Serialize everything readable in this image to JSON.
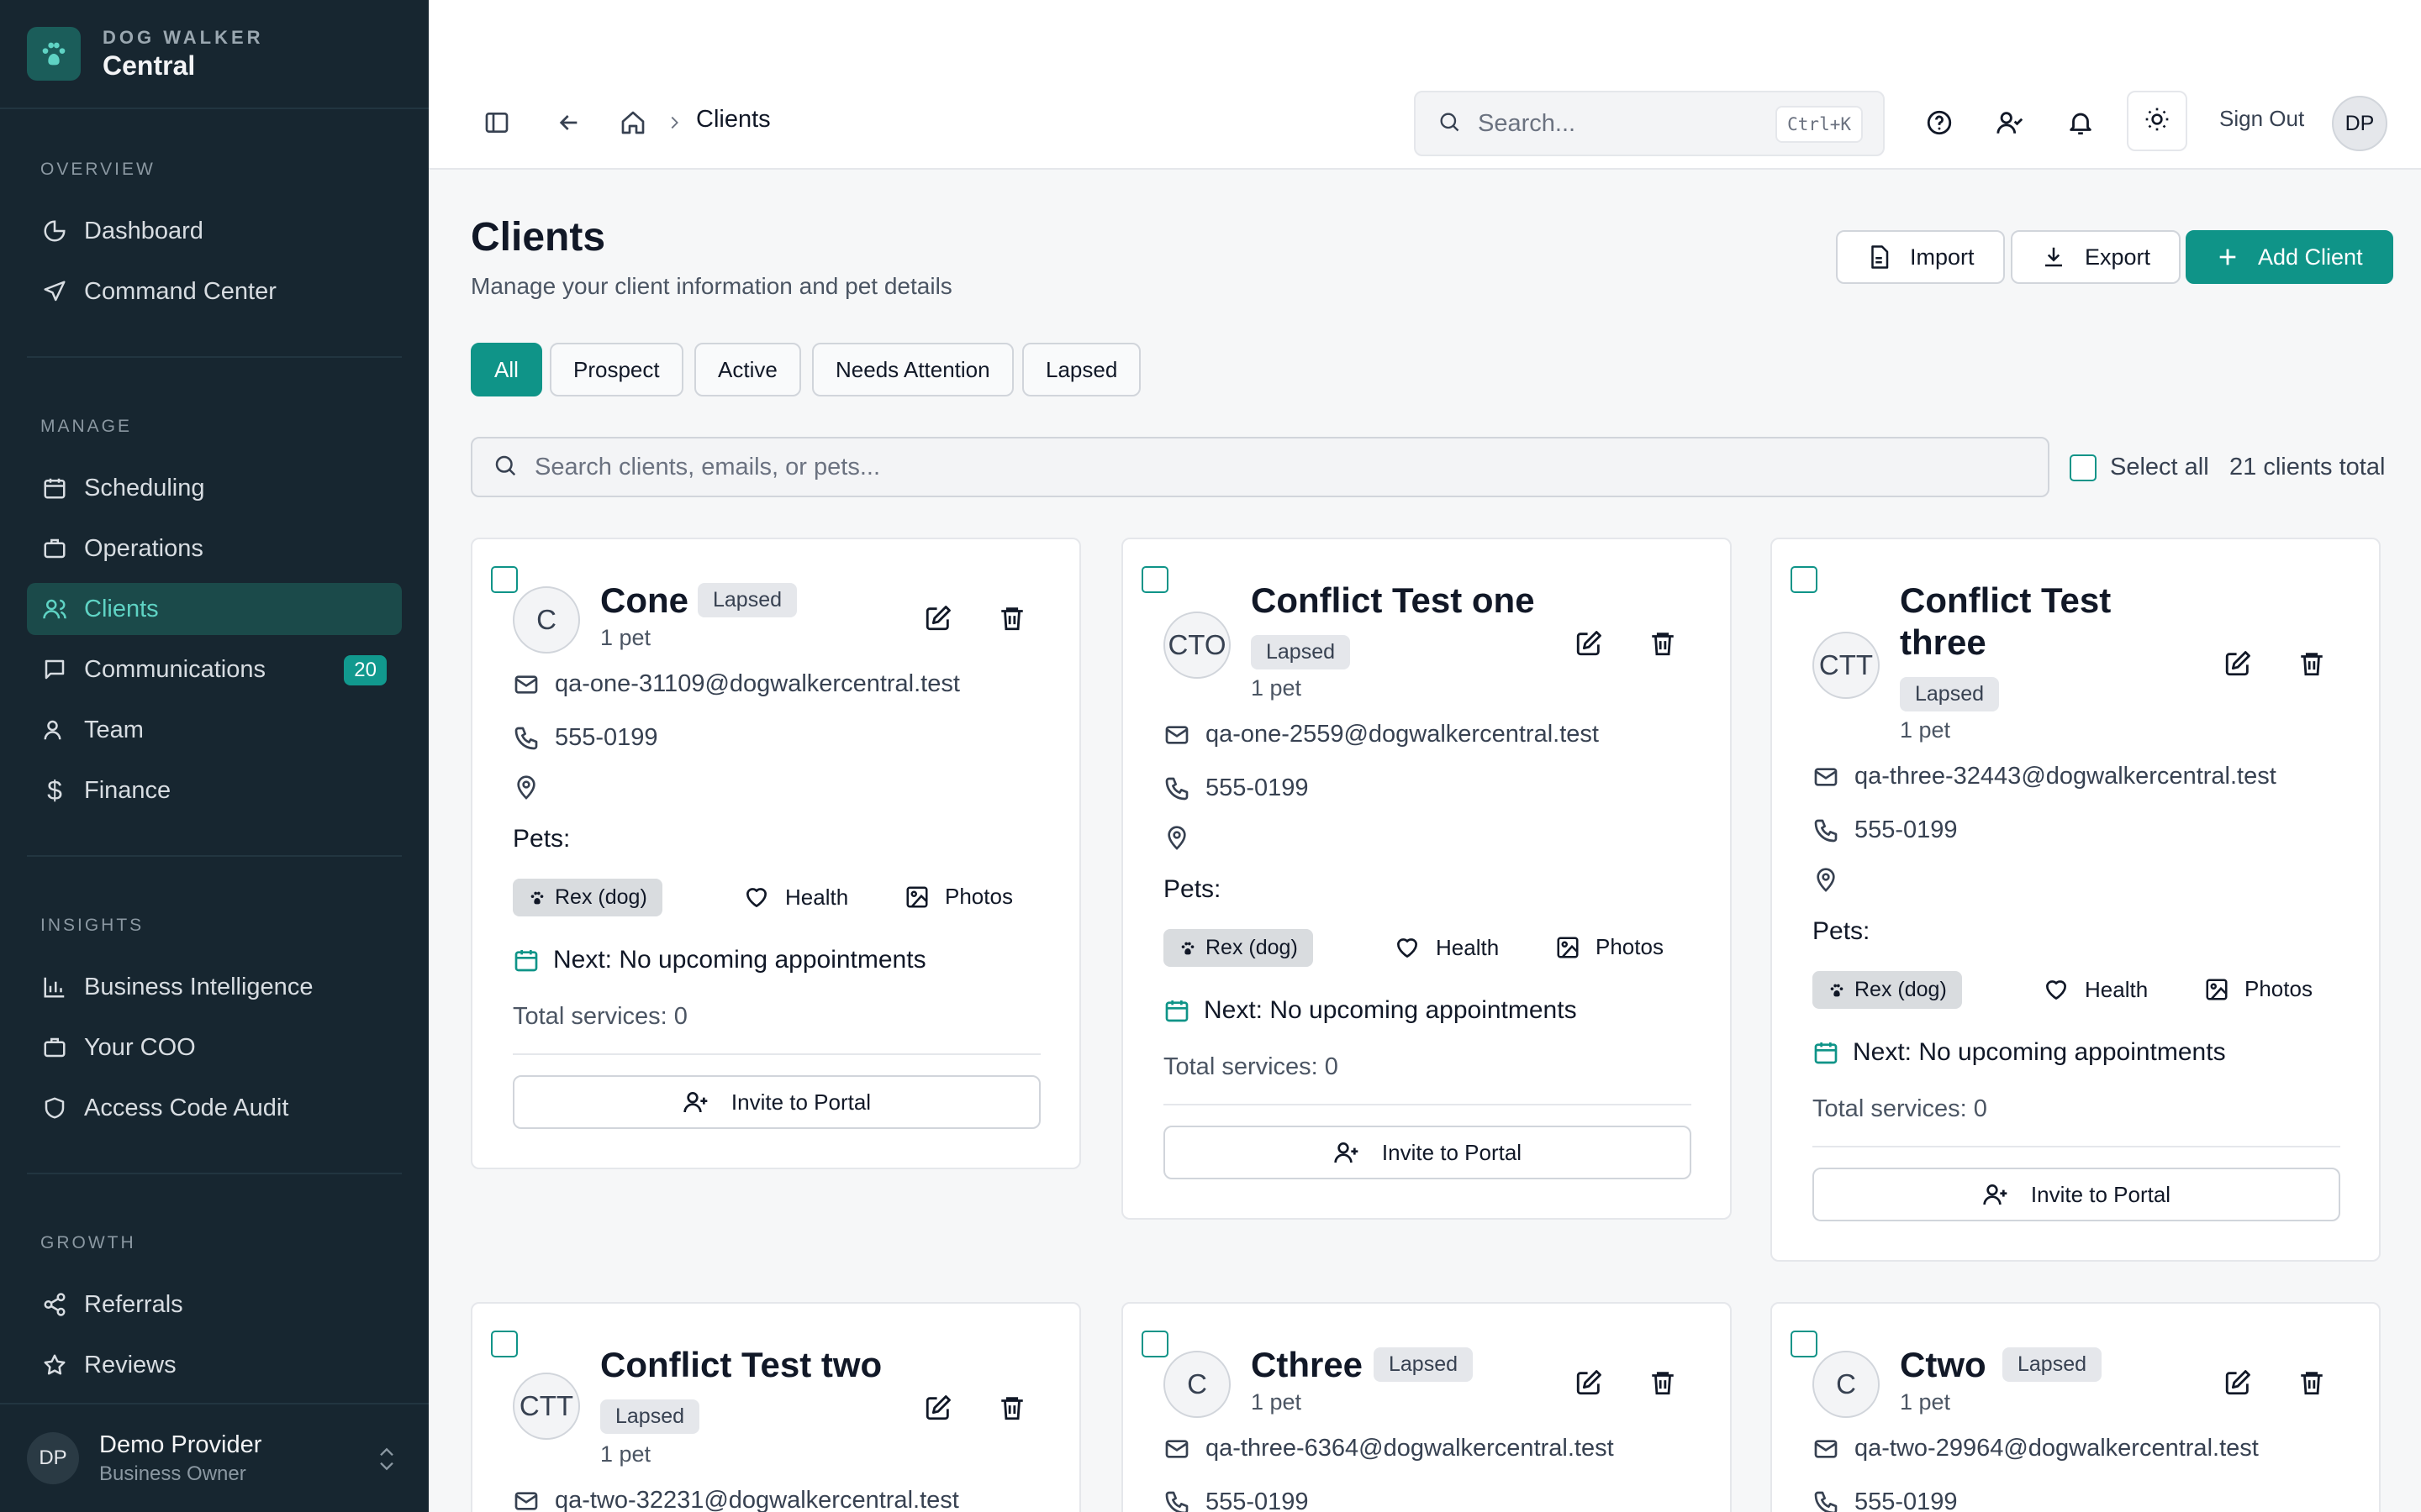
{
  "brand": {
    "sub": "DOG WALKER",
    "main": "Central"
  },
  "nav": {
    "overview_label": "OVERVIEW",
    "manage_label": "MANAGE",
    "insights_label": "INSIGHTS",
    "growth_label": "GROWTH",
    "items": {
      "dashboard": "Dashboard",
      "command_center": "Command Center",
      "scheduling": "Scheduling",
      "operations": "Operations",
      "clients": "Clients",
      "communications": "Communications",
      "communications_badge": "20",
      "team": "Team",
      "finance": "Finance",
      "bi": "Business Intelligence",
      "coo": "Your COO",
      "audit": "Access Code Audit",
      "referrals": "Referrals",
      "reviews": "Reviews"
    }
  },
  "user": {
    "initials": "DP",
    "name": "Demo Provider",
    "role": "Business Owner"
  },
  "topbar": {
    "breadcrumb": "Clients",
    "search_placeholder": "Search...",
    "shortcut": "Ctrl+K",
    "sign_out": "Sign Out",
    "avatar": "DP"
  },
  "page": {
    "title": "Clients",
    "subtitle": "Manage your client information and pet details",
    "import": "Import",
    "export": "Export",
    "add": "Add Client"
  },
  "filters": [
    "All",
    "Prospect",
    "Active",
    "Needs Attention",
    "Lapsed"
  ],
  "search": {
    "placeholder": "Search clients, emails, or pets...",
    "select_all": "Select all",
    "total": "21 clients total"
  },
  "cards": [
    {
      "initials": "C",
      "name": "Cone",
      "status": "Lapsed",
      "pets": "1 pet",
      "email": "qa-one-31109@dogwalkercentral.test",
      "phone": "555-0199",
      "pets_label": "Pets:",
      "pet": "Rex (dog)",
      "health": "Health",
      "photos": "Photos",
      "next": "Next: No upcoming appointments",
      "total": "Total services: 0",
      "invite": "Invite to Portal"
    },
    {
      "initials": "CTO",
      "name": "Conflict Test one",
      "status": "Lapsed",
      "pets": "1 pet",
      "email": "qa-one-2559@dogwalkercentral.test",
      "phone": "555-0199",
      "pets_label": "Pets:",
      "pet": "Rex (dog)",
      "health": "Health",
      "photos": "Photos",
      "next": "Next: No upcoming appointments",
      "total": "Total services: 0",
      "invite": "Invite to Portal"
    },
    {
      "initials": "CTT",
      "name_line1": "Conflict Test",
      "name_line2": "three",
      "status": "Lapsed",
      "pets": "1 pet",
      "email": "qa-three-32443@dogwalkercentral.test",
      "phone": "555-0199",
      "pets_label": "Pets:",
      "pet": "Rex (dog)",
      "health": "Health",
      "photos": "Photos",
      "next": "Next: No upcoming appointments",
      "total": "Total services: 0",
      "invite": "Invite to Portal"
    },
    {
      "initials": "CTT",
      "name": "Conflict Test two",
      "status": "Lapsed",
      "pets": "1 pet",
      "email": "qa-two-32231@dogwalkercentral.test"
    },
    {
      "initials": "C",
      "name": "Cthree",
      "status": "Lapsed",
      "pets": "1 pet",
      "email": "qa-three-6364@dogwalkercentral.test",
      "phone": "555-0199"
    },
    {
      "initials": "C",
      "name": "Ctwo",
      "status": "Lapsed",
      "pets": "1 pet",
      "email": "qa-two-29964@dogwalkercentral.test",
      "phone": "555-0199"
    }
  ]
}
